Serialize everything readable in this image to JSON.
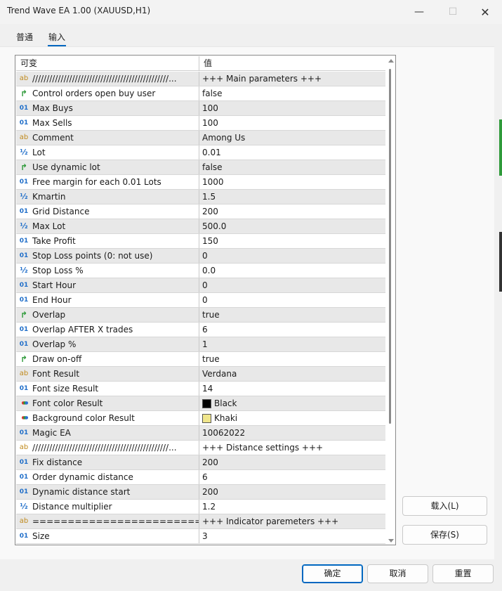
{
  "window": {
    "title": "Trend Wave EA 1.00 (XAUUSD,H1)",
    "minimize_glyph": "—",
    "maximize_glyph": "☐",
    "close_glyph": "✕"
  },
  "tabs": [
    {
      "label": "普通"
    },
    {
      "label": "输入"
    }
  ],
  "grid": {
    "header": {
      "variable": "可变",
      "value": "值"
    },
    "rows": [
      {
        "type": "string",
        "icon": "ab",
        "name": "////////////////////////////////////////////////...",
        "value": "+++ Main parameters +++"
      },
      {
        "type": "bool",
        "icon": "↱",
        "name": "Control orders open buy user",
        "value": "false"
      },
      {
        "type": "int",
        "icon": "01",
        "name": "Max Buys",
        "value": "100"
      },
      {
        "type": "int",
        "icon": "01",
        "name": "Max Sells",
        "value": "100"
      },
      {
        "type": "string",
        "icon": "ab",
        "name": "Comment",
        "value": "Among Us"
      },
      {
        "type": "double",
        "icon": "½",
        "name": "Lot",
        "value": "0.01"
      },
      {
        "type": "bool",
        "icon": "↱",
        "name": "Use dynamic lot",
        "value": "false"
      },
      {
        "type": "int",
        "icon": "01",
        "name": "Free margin for each 0.01 Lots",
        "value": "1000"
      },
      {
        "type": "double",
        "icon": "½",
        "name": "Kmartin",
        "value": "1.5"
      },
      {
        "type": "int",
        "icon": "01",
        "name": "Grid Distance",
        "value": "200"
      },
      {
        "type": "double",
        "icon": "½",
        "name": "Max Lot",
        "value": "500.0"
      },
      {
        "type": "int",
        "icon": "01",
        "name": "Take Profit",
        "value": "150"
      },
      {
        "type": "int",
        "icon": "01",
        "name": "Stop Loss points  (0: not use)",
        "value": "0"
      },
      {
        "type": "double",
        "icon": "½",
        "name": "Stop Loss %",
        "value": "0.0"
      },
      {
        "type": "int",
        "icon": "01",
        "name": "Start Hour",
        "value": "0"
      },
      {
        "type": "int",
        "icon": "01",
        "name": "End Hour",
        "value": "0"
      },
      {
        "type": "bool",
        "icon": "↱",
        "name": "Overlap",
        "value": "true"
      },
      {
        "type": "int",
        "icon": "01",
        "name": "Overlap AFTER X trades",
        "value": "6"
      },
      {
        "type": "int",
        "icon": "01",
        "name": "Overlap %",
        "value": "1"
      },
      {
        "type": "bool",
        "icon": "↱",
        "name": "Draw on-off",
        "value": "true"
      },
      {
        "type": "string",
        "icon": "ab",
        "name": "Font Result",
        "value": "Verdana"
      },
      {
        "type": "int",
        "icon": "01",
        "name": "Font size Result",
        "value": "14"
      },
      {
        "type": "color",
        "icon": "✿",
        "name": "Font color Result",
        "value": "Black",
        "swatch": "#000000"
      },
      {
        "type": "color",
        "icon": "✿",
        "name": "Background color Result",
        "value": "Khaki",
        "swatch": "#f0e68c"
      },
      {
        "type": "int",
        "icon": "01",
        "name": "Magic EA",
        "value": "10062022"
      },
      {
        "type": "string",
        "icon": "ab",
        "name": "////////////////////////////////////////////////...",
        "value": "+++ Distance settings +++"
      },
      {
        "type": "int",
        "icon": "01",
        "name": "Fix distance",
        "value": "200"
      },
      {
        "type": "int",
        "icon": "01",
        "name": "Order dynamic distance",
        "value": "6"
      },
      {
        "type": "int",
        "icon": "01",
        "name": "Dynamic distance start",
        "value": "200"
      },
      {
        "type": "double",
        "icon": "½",
        "name": "Distance multiplier",
        "value": "1.2"
      },
      {
        "type": "string",
        "icon": "ab",
        "name": "=============================...",
        "value": "+++ Indicator paremeters +++"
      },
      {
        "type": "int",
        "icon": "01",
        "name": "Size",
        "value": "3"
      }
    ]
  },
  "side_buttons": {
    "load": "载入(L)",
    "save": "保存(S)"
  },
  "bottom_buttons": {
    "ok": "确定",
    "cancel": "取消",
    "reset": "重置"
  },
  "colors": {
    "accent": "#0067c0",
    "alt_row": "#e8e8e8",
    "int_icon": "#1f6ec9",
    "string_icon": "#c08a1d",
    "bool_icon": "#2f9a3a"
  }
}
